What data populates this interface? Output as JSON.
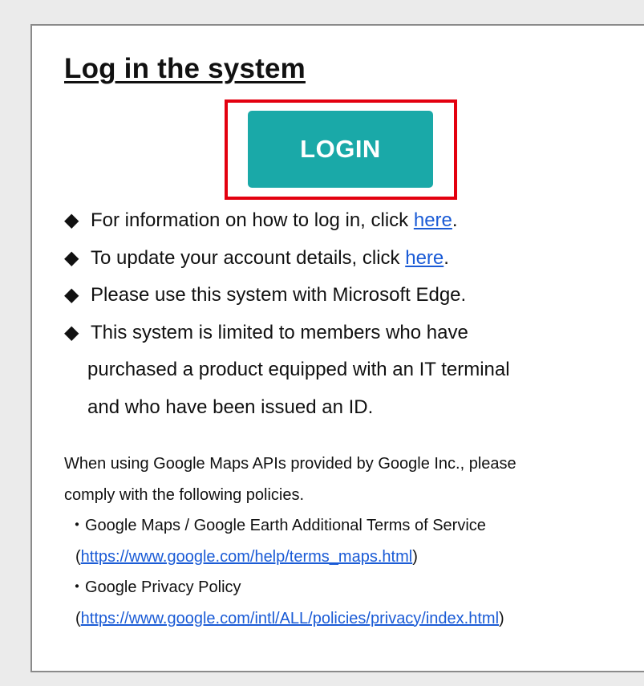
{
  "title": "Log in the system",
  "login_button": "LOGIN",
  "bullet_symbol": "◆",
  "bullets": {
    "info": {
      "prefix": "For information on how to log in, click ",
      "link": "here",
      "suffix": "."
    },
    "update": {
      "prefix": "To update your account details, click ",
      "link": "here",
      "suffix": "."
    },
    "browser": "Please use this system with Microsoft Edge.",
    "members": {
      "line1": "This system is limited to members who have",
      "line2": "purchased a product equipped with an IT terminal",
      "line3": "and who have been issued an ID."
    }
  },
  "maps_notice": {
    "line1": "When using Google Maps APIs provided by Google Inc., please",
    "line2": "comply with the following policies.",
    "policies": [
      {
        "label": "・Google Maps / Google Earth Additional Terms of Service",
        "open": "(",
        "url": "https://www.google.com/help/terms_maps.html",
        "close": ")"
      },
      {
        "label": "・Google Privacy Policy",
        "open": "(",
        "url": "https://www.google.com/intl/ALL/policies/privacy/index.html",
        "close": ")"
      }
    ]
  },
  "colors": {
    "login_button": "#1aa9a8",
    "highlight_border": "#e3000f",
    "link": "#1a5bd6",
    "panel_border": "#8a8a8a",
    "page_background": "#ebebeb"
  }
}
